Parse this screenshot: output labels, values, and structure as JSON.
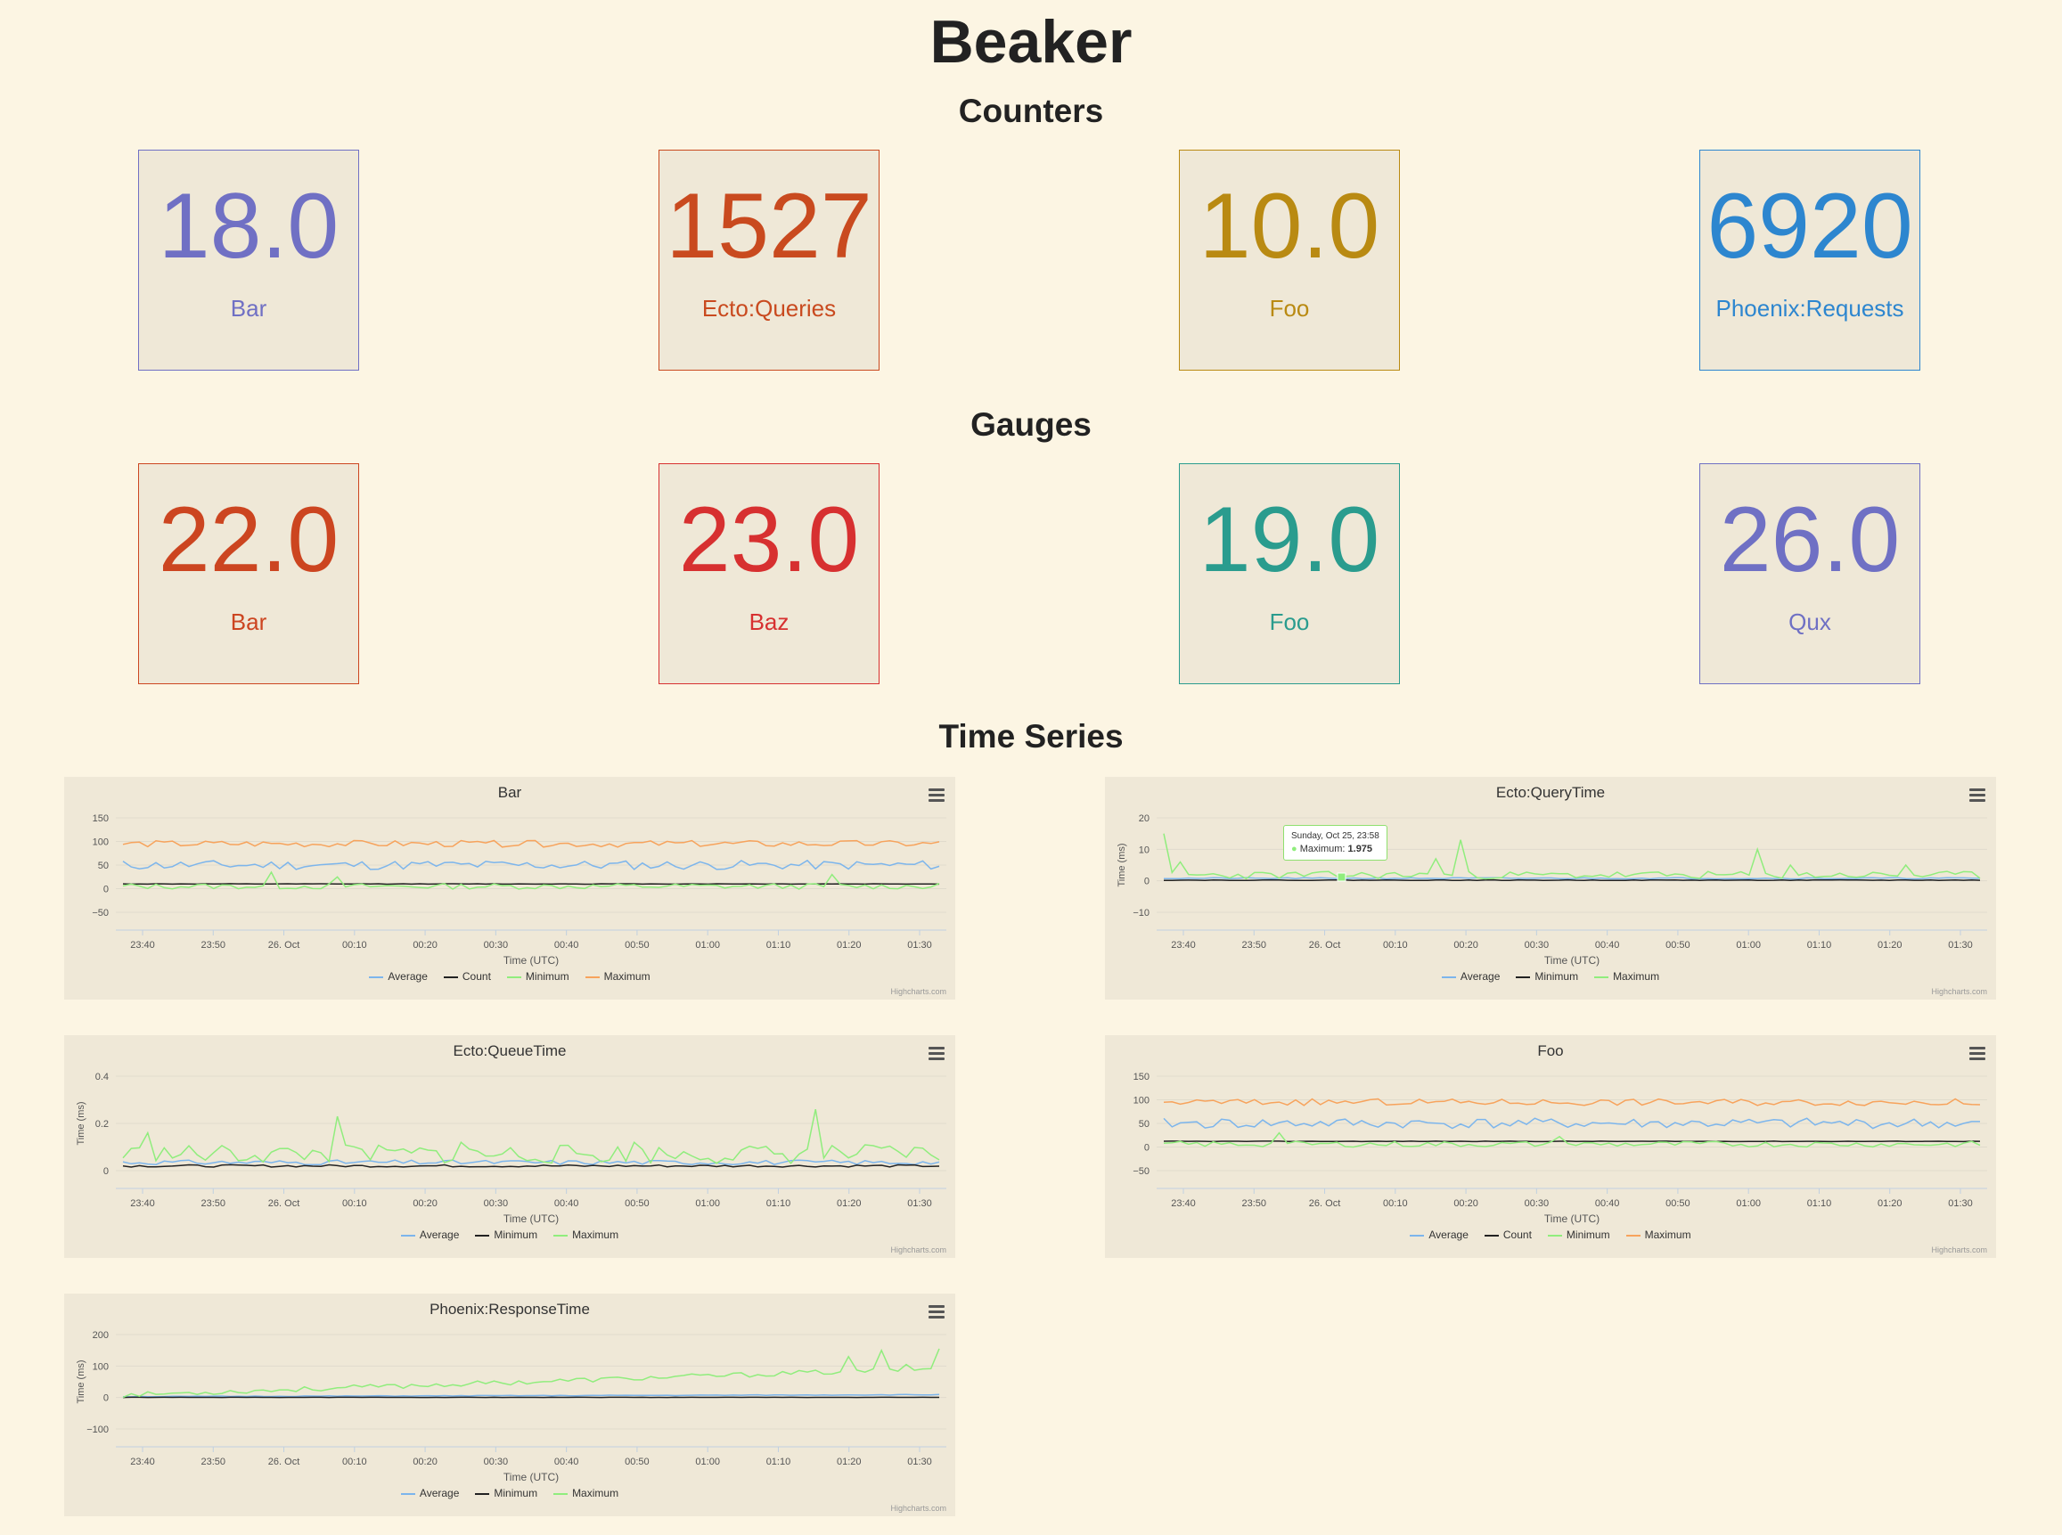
{
  "page": {
    "title": "Beaker",
    "sections": {
      "counters": "Counters",
      "gauges": "Gauges",
      "time_series": "Time Series"
    }
  },
  "counters": [
    {
      "value": "18.0",
      "label": "Bar",
      "color": "#7070c4"
    },
    {
      "value": "1527",
      "label": "Ecto:Queries",
      "color": "#c94a1f"
    },
    {
      "value": "10.0",
      "label": "Foo",
      "color": "#b98a12"
    },
    {
      "value": "6920",
      "label": "Phoenix:Requests",
      "color": "#2d86cf"
    }
  ],
  "gauges": [
    {
      "value": "22.0",
      "label": "Bar",
      "color": "#cc4520"
    },
    {
      "value": "23.0",
      "label": "Baz",
      "color": "#d73030"
    },
    {
      "value": "19.0",
      "label": "Foo",
      "color": "#2a9c8e"
    },
    {
      "value": "26.0",
      "label": "Qux",
      "color": "#6f70c4"
    }
  ],
  "series_colors": {
    "Average": "#7cb5ec",
    "Count": "#222222",
    "Minimum": "#90ed7d",
    "Maximum": "#f7a35c"
  },
  "chart_credit": "Highcharts.com",
  "chart_data": [
    {
      "type": "line",
      "title": "Bar",
      "xlabel": "Time (UTC)",
      "ylabel": "",
      "ylim": [
        -50,
        150
      ],
      "yticks": [
        "150",
        "100",
        "50",
        "0",
        "−50"
      ],
      "xticks": [
        "23:40",
        "23:50",
        "26. Oct",
        "00:10",
        "00:20",
        "00:30",
        "00:40",
        "00:50",
        "01:00",
        "01:10",
        "01:20",
        "01:30"
      ],
      "legend": "bottom",
      "series": [
        {
          "name": "Average",
          "color": "#7cb5ec",
          "base": 50,
          "amp": 10,
          "seed": 11
        },
        {
          "name": "Count",
          "color": "#222222",
          "base": 10,
          "amp": 0.5,
          "seed": 12
        },
        {
          "name": "Minimum",
          "color": "#90ed7d",
          "base": 5,
          "amp": 6,
          "seed": 13,
          "spikes": [
            [
              18,
              35
            ],
            [
              26,
              25
            ],
            [
              86,
              30
            ]
          ]
        },
        {
          "name": "Maximum",
          "color": "#f7a35c",
          "base": 95,
          "amp": 7,
          "seed": 14
        }
      ]
    },
    {
      "type": "line",
      "title": "Ecto:QueryTime",
      "xlabel": "Time (UTC)",
      "ylabel": "Time (ms)",
      "ylim": [
        -10,
        20
      ],
      "yticks": [
        "20",
        "10",
        "0",
        "−10"
      ],
      "xticks": [
        "23:40",
        "23:50",
        "26. Oct",
        "00:10",
        "00:20",
        "00:30",
        "00:40",
        "00:50",
        "01:00",
        "01:10",
        "01:20",
        "01:30"
      ],
      "legend": "bottom",
      "tooltip": {
        "time": "Sunday, Oct 25, 23:58",
        "label": "Maximum:",
        "value": "1.975"
      },
      "series": [
        {
          "name": "Average",
          "color": "#7cb5ec",
          "base": 0.8,
          "amp": 0.2,
          "seed": 21
        },
        {
          "name": "Minimum",
          "color": "#222222",
          "base": 0.2,
          "amp": 0.1,
          "seed": 22
        },
        {
          "name": "Maximum",
          "color": "#90ed7d",
          "base": 1.8,
          "amp": 1.2,
          "seed": 23,
          "spikes": [
            [
              0,
              15
            ],
            [
              2,
              6
            ],
            [
              36,
              13
            ],
            [
              33,
              7
            ],
            [
              72,
              10
            ],
            [
              76,
              5
            ],
            [
              90,
              5
            ]
          ]
        }
      ]
    },
    {
      "type": "line",
      "title": "Ecto:QueueTime",
      "xlabel": "Time (UTC)",
      "ylabel": "Time (ms)",
      "ylim": [
        0,
        0.4
      ],
      "yticks": [
        "0.4",
        "0.2",
        "0"
      ],
      "xticks": [
        "23:40",
        "23:50",
        "26. Oct",
        "00:10",
        "00:20",
        "00:30",
        "00:40",
        "00:50",
        "01:00",
        "01:10",
        "01:20",
        "01:30"
      ],
      "legend": "bottom",
      "series": [
        {
          "name": "Average",
          "color": "#7cb5ec",
          "base": 0.035,
          "amp": 0.01,
          "seed": 31
        },
        {
          "name": "Minimum",
          "color": "#222222",
          "base": 0.02,
          "amp": 0.005,
          "seed": 32
        },
        {
          "name": "Maximum",
          "color": "#90ed7d",
          "base": 0.07,
          "amp": 0.04,
          "seed": 33,
          "spikes": [
            [
              3,
              0.16
            ],
            [
              26,
              0.23
            ],
            [
              41,
              0.12
            ],
            [
              62,
              0.12
            ],
            [
              84,
              0.26
            ]
          ]
        }
      ]
    },
    {
      "type": "line",
      "title": "Foo",
      "xlabel": "Time (UTC)",
      "ylabel": "",
      "ylim": [
        -50,
        150
      ],
      "yticks": [
        "150",
        "100",
        "50",
        "0",
        "−50"
      ],
      "xticks": [
        "23:40",
        "23:50",
        "26. Oct",
        "00:10",
        "00:20",
        "00:30",
        "00:40",
        "00:50",
        "01:00",
        "01:10",
        "01:20",
        "01:30"
      ],
      "legend": "bottom",
      "series": [
        {
          "name": "Average",
          "color": "#7cb5ec",
          "base": 50,
          "amp": 11,
          "seed": 41
        },
        {
          "name": "Count",
          "color": "#222222",
          "base": 12,
          "amp": 0.5,
          "seed": 42
        },
        {
          "name": "Minimum",
          "color": "#90ed7d",
          "base": 6,
          "amp": 6,
          "seed": 43,
          "spikes": [
            [
              14,
              30
            ],
            [
              48,
              22
            ]
          ]
        },
        {
          "name": "Maximum",
          "color": "#f7a35c",
          "base": 95,
          "amp": 7,
          "seed": 44
        }
      ]
    },
    {
      "type": "line",
      "title": "Phoenix:ResponseTime",
      "xlabel": "Time (UTC)",
      "ylabel": "Time (ms)",
      "ylim": [
        -100,
        200
      ],
      "yticks": [
        "200",
        "100",
        "0",
        "−100"
      ],
      "xticks": [
        "23:40",
        "23:50",
        "26. Oct",
        "00:10",
        "00:20",
        "00:30",
        "00:40",
        "00:50",
        "01:00",
        "01:10",
        "01:20",
        "01:30"
      ],
      "legend": "bottom",
      "series": [
        {
          "name": "Average",
          "color": "#7cb5ec",
          "base": 3,
          "amp": 1,
          "seed": 51,
          "trend": 6
        },
        {
          "name": "Minimum",
          "color": "#222222",
          "base": 0.5,
          "amp": 0.3,
          "seed": 52
        },
        {
          "name": "Maximum",
          "color": "#90ed7d",
          "base": 8,
          "amp": 8,
          "seed": 53,
          "trend": 85,
          "spikes": [
            [
              88,
              130
            ],
            [
              92,
              150
            ],
            [
              95,
              105
            ],
            [
              99,
              155
            ]
          ]
        }
      ]
    }
  ]
}
